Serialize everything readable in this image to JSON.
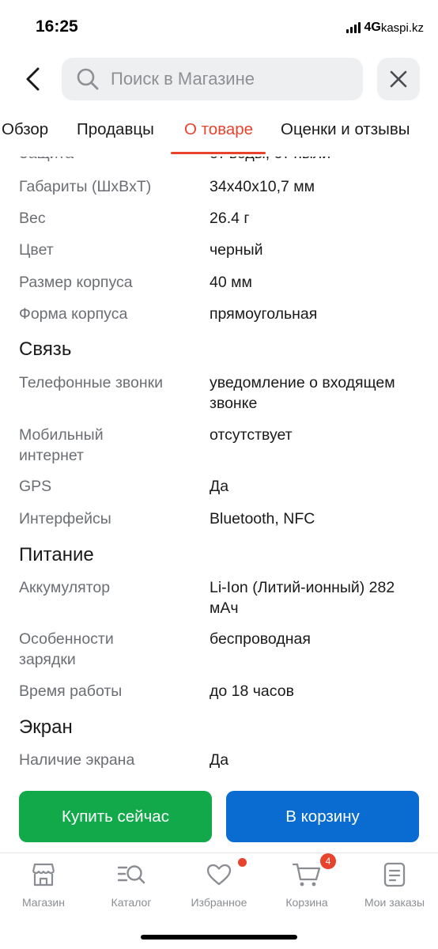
{
  "status_bar": {
    "time": "16:25",
    "network": "4G",
    "watermark": "kaspi.kz"
  },
  "search": {
    "placeholder": "Поиск в Магазине",
    "value": ""
  },
  "tabs": [
    {
      "label": "Обзор",
      "active": false
    },
    {
      "label": "Продавцы",
      "active": false
    },
    {
      "label": "О товаре",
      "active": true
    },
    {
      "label": "Оценки и отзывы",
      "active": false
    }
  ],
  "specs": {
    "partial_row": {
      "name": "Защита",
      "value": "от воды, от пыли"
    },
    "rows": [
      {
        "name": "Габариты (ШxВxТ)",
        "value": "34x40x10,7 мм"
      },
      {
        "name": "Вес",
        "value": "26.4 г"
      },
      {
        "name": "Цвет",
        "value": "черный"
      },
      {
        "name": "Размер корпуса",
        "value": "40 мм"
      },
      {
        "name": "Форма корпуса",
        "value": "прямоугольная"
      }
    ],
    "sections": [
      {
        "title": "Связь",
        "rows": [
          {
            "name": "Телефонные звонки",
            "value": "уведомление о входящем звонке"
          },
          {
            "name": "Мобильный интернет",
            "value": "отсутствует"
          },
          {
            "name": "GPS",
            "value": "Да"
          },
          {
            "name": "Интерфейсы",
            "value": "Bluetooth, NFC"
          }
        ]
      },
      {
        "title": "Питание",
        "rows": [
          {
            "name": "Аккумулятор",
            "value": "Li-Ion (Литий-ионный) 282 мАч"
          },
          {
            "name": "Особенности зарядки",
            "value": "беспроводная"
          },
          {
            "name": "Время работы",
            "value": "до 18 часов"
          }
        ]
      },
      {
        "title": "Экран",
        "rows": [
          {
            "name": "Наличие экрана",
            "value": "Да"
          }
        ]
      }
    ]
  },
  "actions": {
    "buy_now": "Купить сейчас",
    "add_to_cart": "В корзину"
  },
  "bottom_nav": {
    "items": [
      {
        "label": "Магазин",
        "icon": "store-icon"
      },
      {
        "label": "Каталог",
        "icon": "catalog-search-icon"
      },
      {
        "label": "Избранное",
        "icon": "heart-icon"
      },
      {
        "label": "Корзина",
        "icon": "cart-icon",
        "badge": "4"
      },
      {
        "label": "Мои заказы",
        "icon": "orders-icon"
      }
    ]
  },
  "colors": {
    "accent": "#e8432d",
    "buy": "#12a94b",
    "cart": "#0a6cd1",
    "muted": "#6b6e73"
  }
}
